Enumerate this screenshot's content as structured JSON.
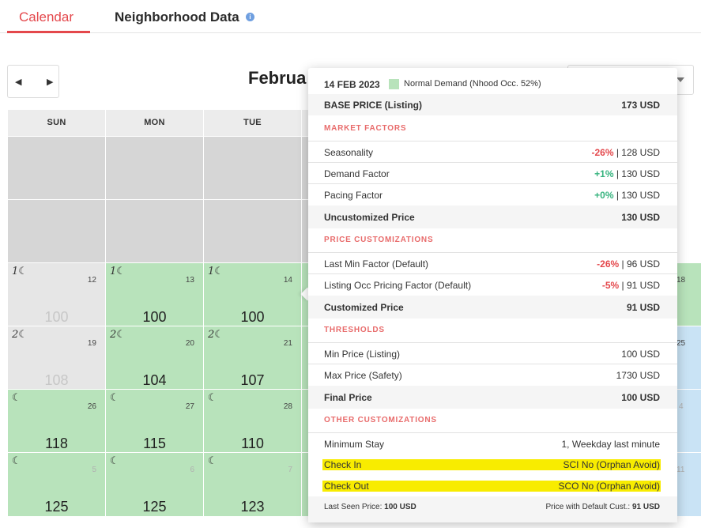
{
  "tabs": {
    "calendar": "Calendar",
    "neighborhood": "Neighborhood Data",
    "info": "i"
  },
  "nav": {
    "prev": "◀",
    "next": "▶",
    "month": "Februa"
  },
  "days": [
    "SUN",
    "MON",
    "TUE"
  ],
  "calendar": {
    "w3": [
      {
        "moon": "1",
        "num": "12",
        "price": "100"
      },
      {
        "moon": "1",
        "num": "13",
        "price": "100"
      },
      {
        "moon": "1",
        "num": "14",
        "price": "100"
      }
    ],
    "w4": [
      {
        "moon": "2",
        "num": "19",
        "price": "108"
      },
      {
        "moon": "2",
        "num": "20",
        "price": "104"
      },
      {
        "moon": "2",
        "num": "21",
        "price": "107"
      }
    ],
    "w5": [
      {
        "num": "26",
        "price": "118"
      },
      {
        "num": "27",
        "price": "115"
      },
      {
        "num": "28",
        "price": "110"
      }
    ],
    "w6": [
      {
        "num": "5",
        "price": "125"
      },
      {
        "num": "6",
        "price": "125"
      },
      {
        "num": "7",
        "price": "123"
      }
    ],
    "right": {
      "r3": "18",
      "r4": "25",
      "r5": "4",
      "r6": "11"
    }
  },
  "tooltip": {
    "date": "14 FEB 2023",
    "demand": "Normal Demand (Nhood Occ. 52%)",
    "base": {
      "label": "BASE PRICE (Listing)",
      "value": "173 USD"
    },
    "market_title": "MARKET FACTORS",
    "seasonality": {
      "label": "Seasonality",
      "pct": "-26%",
      "rest": "| 128 USD"
    },
    "demand_factor": {
      "label": "Demand Factor",
      "pct": "+1%",
      "rest": "| 130 USD"
    },
    "pacing": {
      "label": "Pacing Factor",
      "pct": "+0%",
      "rest": "| 130 USD"
    },
    "uncustomized": {
      "label": "Uncustomized Price",
      "value": "130 USD"
    },
    "custom_title": "PRICE CUSTOMIZATIONS",
    "lastmin": {
      "label": "Last Min Factor (Default)",
      "pct": "-26%",
      "rest": "| 96 USD"
    },
    "occ": {
      "label": "Listing Occ Pricing Factor (Default)",
      "pct": "-5%",
      "rest": "| 91 USD"
    },
    "customized": {
      "label": "Customized Price",
      "value": "91 USD"
    },
    "thresholds_title": "THRESHOLDS",
    "minprice": {
      "label": "Min Price (Listing)",
      "value": "100 USD"
    },
    "maxprice": {
      "label": "Max Price (Safety)",
      "value": "1730 USD"
    },
    "final": {
      "label": "Final Price",
      "value": "100 USD"
    },
    "other_title": "OTHER CUSTOMIZATIONS",
    "minstay": {
      "label": "Minimum Stay",
      "value": "1, Weekday last minute"
    },
    "checkin": {
      "label": "Check In",
      "value": "SCI No (Orphan Avoid)"
    },
    "checkout": {
      "label": "Check Out",
      "value": "SCO No (Orphan Avoid)"
    },
    "footer": {
      "last_seen_label": "Last Seen Price:",
      "last_seen_value": "100 USD",
      "default_label": "Price with Default Cust.:",
      "default_value": "91 USD"
    }
  },
  "colors": {
    "accent": "#e4484c",
    "available": "#b8e3bb",
    "positive": "#36b37e",
    "highlight": "#f8ec00"
  },
  "icons": {
    "moon": "moon-icon",
    "caret": "chevron-down-icon"
  }
}
